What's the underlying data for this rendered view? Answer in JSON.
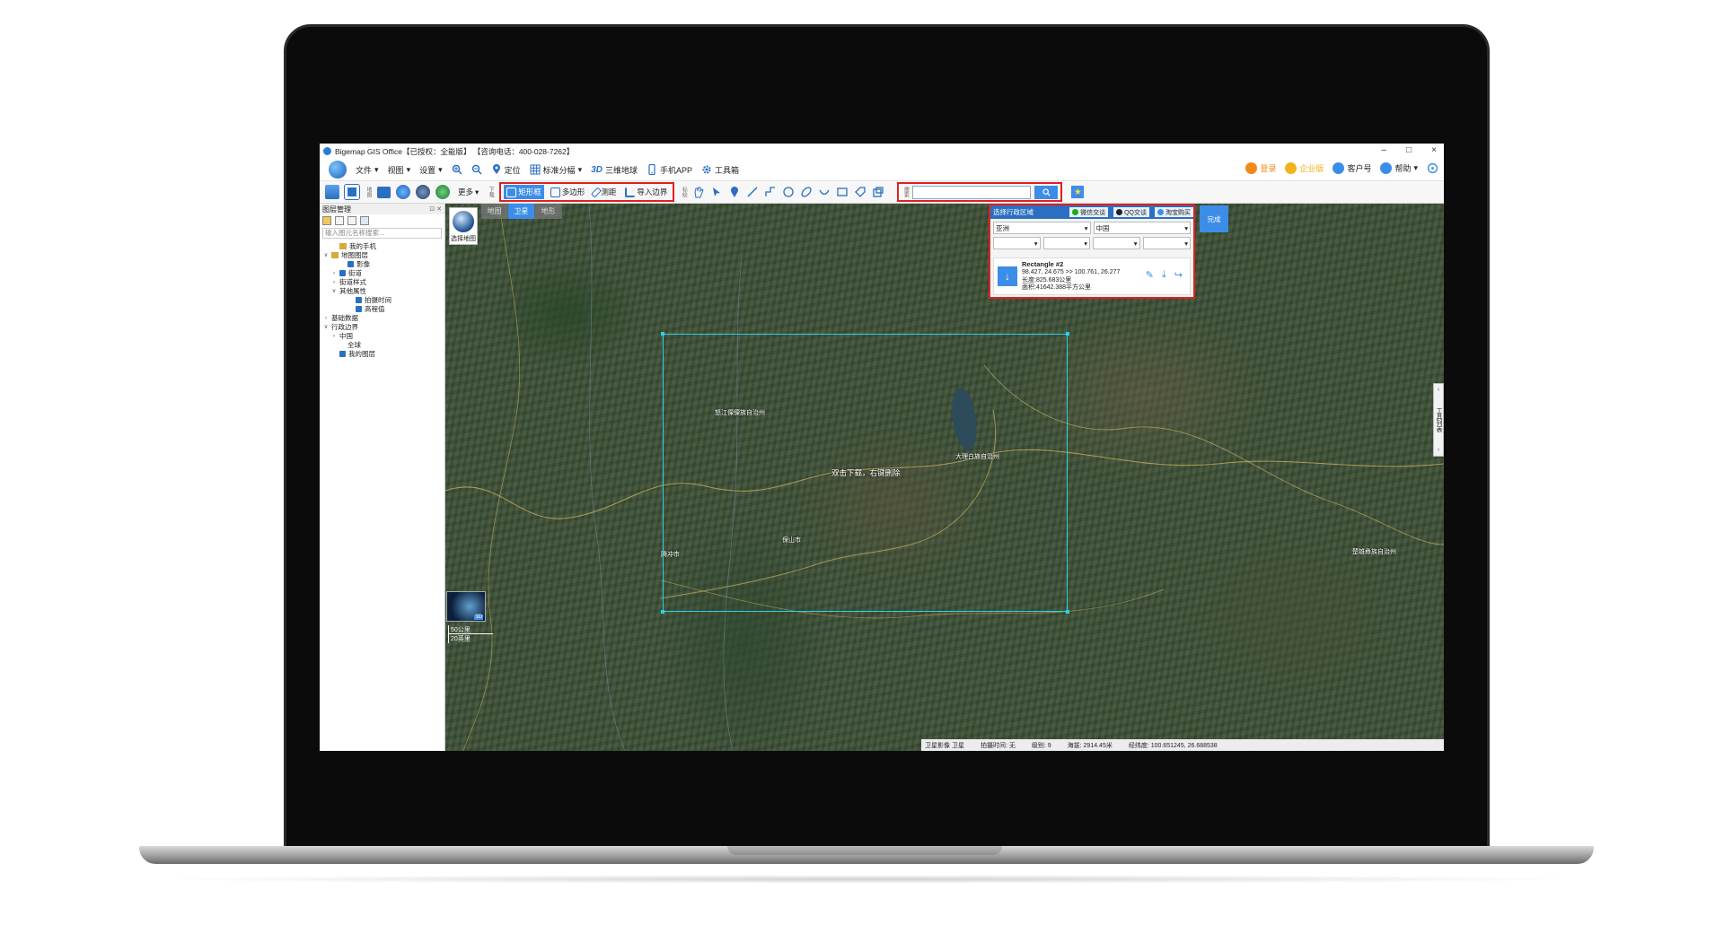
{
  "window": {
    "title": "Bigemap GIS Office【已授权：全能版】   【咨询电话：400-028-7262】",
    "controls": [
      "–",
      "□",
      "×"
    ]
  },
  "menubar": {
    "items": [
      {
        "label": "文件",
        "arrow": "▾"
      },
      {
        "label": "视图",
        "arrow": "▾"
      },
      {
        "label": "设置",
        "arrow": "▾"
      }
    ],
    "tools": [
      {
        "label": "定位",
        "icon": "location-pin-icon"
      },
      {
        "label": "标准分幅",
        "icon": "grid-icon",
        "arrow": "▾"
      },
      {
        "label": "三维地球",
        "icon": "3d-icon",
        "badge": "3D"
      },
      {
        "label": "手机APP",
        "icon": "phone-icon"
      },
      {
        "label": "工具箱",
        "icon": "gear-icon"
      }
    ],
    "right": [
      {
        "label": "登录",
        "icon": "user-icon",
        "color": "#f28a1b"
      },
      {
        "label": "企业版",
        "icon": "crown-icon",
        "color": "#f2b21b"
      },
      {
        "label": "客户号",
        "icon": "qq-icon",
        "color": "#3c8de8"
      },
      {
        "label": "帮助",
        "icon": "help-icon",
        "color": "#3c8de8",
        "arrow": "▾"
      }
    ]
  },
  "toolbar": {
    "more_label": "更多",
    "more_arrow": "▾",
    "left_group_label": "地图",
    "download_group_label": "下载",
    "download_tools": [
      {
        "label": "矩形框",
        "active": true
      },
      {
        "label": "多边形",
        "active": false
      },
      {
        "label": "测距",
        "active": false
      },
      {
        "label": "导入边界",
        "active": false
      }
    ],
    "draw_group_label": "标绘",
    "search_group_label": "搜索",
    "search_placeholder": ""
  },
  "layer_panel": {
    "title": "图层管理",
    "search_placeholder": "输入图元名称搜索...",
    "tree": [
      {
        "label": "我的手机",
        "indent": 1,
        "checked": false,
        "folder": true
      },
      {
        "label": "地图图层",
        "indent": 0,
        "toggle": "∨",
        "folder": true
      },
      {
        "label": "影像",
        "indent": 2,
        "checked": true
      },
      {
        "label": "街道",
        "indent": 1,
        "toggle": "›",
        "checked": true
      },
      {
        "label": "街道样式",
        "indent": 1,
        "toggle": "›"
      },
      {
        "label": "其他属性",
        "indent": 1,
        "toggle": "∨"
      },
      {
        "label": "拍摄时间",
        "indent": 3,
        "checked": true
      },
      {
        "label": "高程值",
        "indent": 3,
        "checked": true
      },
      {
        "label": "基础数据",
        "indent": 0,
        "toggle": "›"
      },
      {
        "label": "行政边界",
        "indent": 0,
        "toggle": "∨"
      },
      {
        "label": "中国",
        "indent": 1,
        "toggle": "›"
      },
      {
        "label": "全球",
        "indent": 2
      },
      {
        "label": "我的图层",
        "indent": 1,
        "checked": true
      }
    ]
  },
  "map": {
    "tabs": [
      {
        "label": "地图",
        "active": false
      },
      {
        "label": "卫星",
        "active": true
      },
      {
        "label": "地形",
        "active": false
      }
    ],
    "select_map_label": "选择地图",
    "hint": "双击下载，右键删除",
    "places": [
      "怒江傈僳族自治州",
      "大理白族自治州",
      "保山市",
      "腾冲市",
      "楚雄彝族自治州"
    ],
    "scale_top": "50公里",
    "scale_bottom": "20英里",
    "minimap_badge": "3D",
    "side_tab_label": "工具列表",
    "side_tab_arrow": "‹",
    "status": {
      "imagery": "卫星影像 卫星",
      "shot_time": "拍摄时间: 无",
      "level": "级别: 9",
      "elevation": "海拔: 2914.45米",
      "lonlat": "经纬度: 100.651245, 26.688538"
    }
  },
  "region_panel": {
    "title": "选择行政区域",
    "share": [
      {
        "label": "微信交谈",
        "color": "#1aad19"
      },
      {
        "label": "QQ交谈",
        "color": "#222222"
      },
      {
        "label": "淘宝购买",
        "color": "#3c8de8"
      }
    ],
    "continent": "亚洲",
    "country": "中国",
    "card": {
      "name": "Rectangle #2",
      "coords": "98.427, 24.675 >> 100.761, 26.277",
      "length": "长度:825.683公里",
      "area": "面积:41642.388平方公里",
      "download_icon": "↓"
    },
    "done_label": "完成"
  }
}
